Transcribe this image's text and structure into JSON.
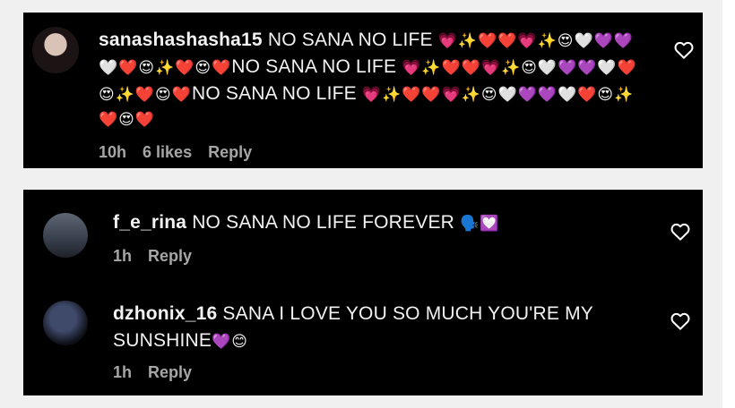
{
  "comments": [
    {
      "username": "sanashashasha15",
      "lines": [
        " NO SANA NO LIFE ",
        "",
        "NO SANA NO LIFE ",
        "",
        "NO SANA NO LIFE ",
        ""
      ],
      "emoji_runs": [
        "💗✨❤️❤️💗✨😍🤍💜💜",
        "🤍❤️😍✨❤️😍❤️",
        "💗✨❤️❤️💗✨😍🤍💜💜🤍❤️",
        "😍✨❤️😍❤️",
        "💗✨❤️❤️💗✨😍🤍💜💜🤍❤️😍✨",
        "❤️😍❤️"
      ],
      "time": "10h",
      "likes": "6 likes",
      "reply": "Reply"
    },
    {
      "username": "f_e_rina",
      "text": " NO SANA NO LIFE FOREVER ",
      "emoji": "🗣️💟",
      "time": "1h",
      "reply": "Reply"
    },
    {
      "username": "dzhonix_16",
      "text1": " SANA I LOVE YOU SO MUCH YOU'RE MY",
      "text2": "SUNSHINE",
      "emoji": "💜😊",
      "time": "1h",
      "reply": "Reply"
    }
  ]
}
